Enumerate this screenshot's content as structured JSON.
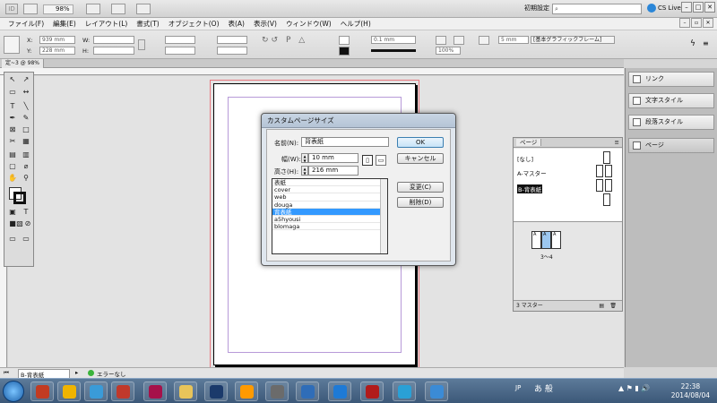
{
  "appbar": {
    "logo": "ID",
    "zoom": "98%",
    "workspace": "初期設定",
    "search_placeholder": "",
    "cslive": "CS Live"
  },
  "menu": [
    "ファイル(F)",
    "編集(E)",
    "レイアウト(L)",
    "書式(T)",
    "オブジェクト(O)",
    "表(A)",
    "表示(V)",
    "ウィンドウ(W)",
    "ヘルプ(H)"
  ],
  "control": {
    "x_label": "X:",
    "x_value": "939 mm",
    "y_label": "Y:",
    "y_value": "228 mm",
    "w_label": "W:",
    "h_label": "H:",
    "stroke_value": "0.1 mm",
    "pct_value": "100%",
    "gutter_value": "5 mm",
    "style_value": "[基本グラフィックフレーム]"
  },
  "document": {
    "tab": "定~3 @ 98%",
    "status_page": "B-背表紙",
    "status_error": "エラーなし"
  },
  "dock": [
    "リンク",
    "文字スタイル",
    "段落スタイル",
    "ページ"
  ],
  "pages_panel": {
    "tab": "ページ",
    "masters": [
      "[なし]",
      "A-マスター",
      "B-背表紙"
    ],
    "spread_label": "3～4",
    "page_letters": [
      "A",
      "A",
      "A"
    ],
    "footer": "3 マスター"
  },
  "dialog": {
    "title": "カスタムページサイズ",
    "name_label": "名前(N):",
    "name_value": "背表紙",
    "width_label": "幅(W):",
    "width_value": "10 mm",
    "height_label": "高さ(H):",
    "height_value": "216 mm",
    "ok": "OK",
    "cancel": "キャンセル",
    "change": "変更(C)",
    "delete": "削除(D)",
    "list": [
      "表紙",
      "cover",
      "web",
      "douga",
      "背表紙",
      "a5hyousi",
      "blomaga"
    ],
    "selected_index": 4
  },
  "taskbar": {
    "lang": "JP",
    "ime": "あ 般",
    "time": "22:38",
    "date": "2014/08/04",
    "app_colors": [
      "#c23b22",
      "#f0b400",
      "#3a9bd8",
      "#c0392b",
      "#a6114a",
      "#e8c45a",
      "#1b3a6b",
      "#ff9a00",
      "#6b6b6b",
      "#2f6db8",
      "#1e7ad6",
      "#b11b1b",
      "#2aa0d6",
      "#3b8bd6"
    ]
  },
  "colors": {
    "accent": "#3399ff",
    "bleed": "#e8787f",
    "margin": "#b79ad8"
  }
}
